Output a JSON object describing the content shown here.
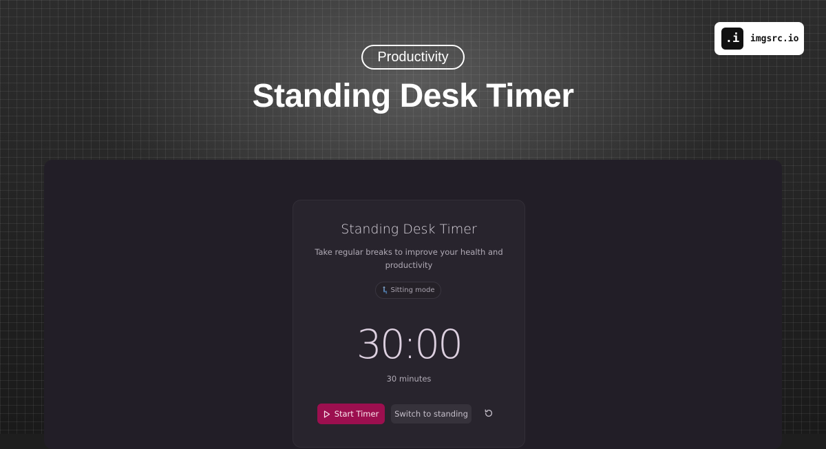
{
  "brand": {
    "mark": ".i",
    "name": "imgsrc.io"
  },
  "hero": {
    "category": "Productivity",
    "title": "Standing Desk Timer"
  },
  "timer_card": {
    "title": "Standing Desk Timer",
    "subtitle": "Take regular breaks to improve your health and productivity",
    "mode_icon": "sitting-person-icon",
    "mode_label": "Sitting mode",
    "time_display": "30:00",
    "duration_label": "30 minutes",
    "start_icon": "play-icon",
    "start_label": "Start Timer",
    "switch_label": "Switch to standing",
    "reset_icon": "reset-icon"
  },
  "colors": {
    "accent": "#9c0f4f",
    "card_bg": "#28242d",
    "frame_bg": "#221e27",
    "clock_text": "#ddd0e0"
  }
}
